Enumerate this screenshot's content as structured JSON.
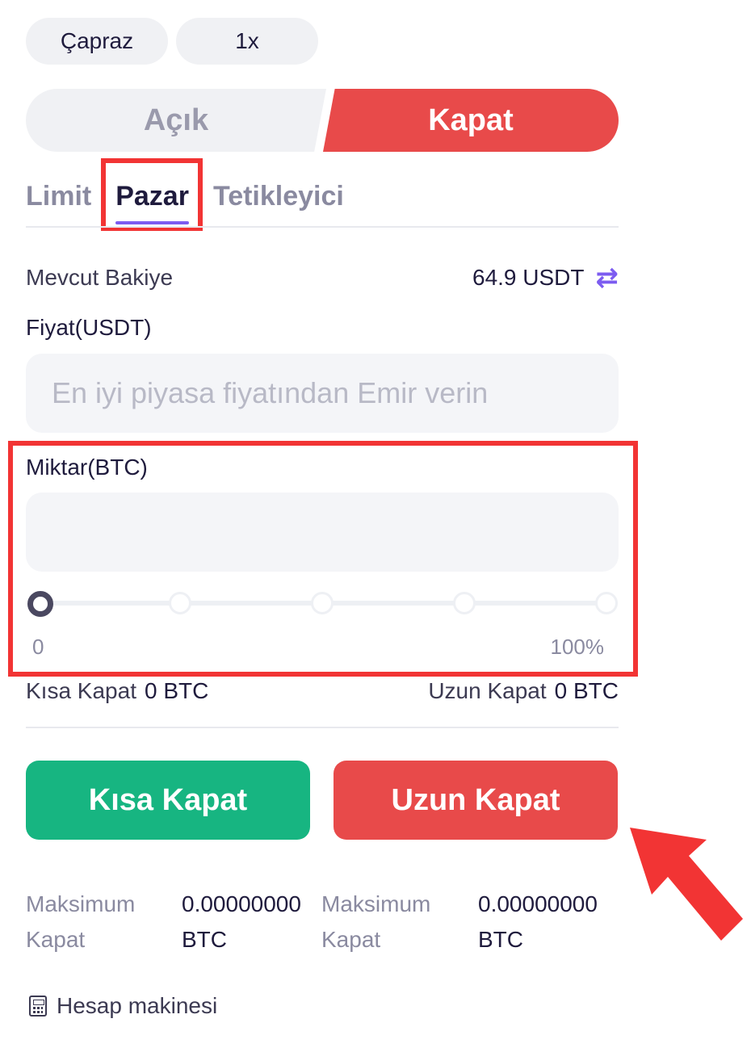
{
  "header": {
    "margin_mode": "Çapraz",
    "leverage": "1x"
  },
  "side_toggle": {
    "open_label": "Açık",
    "close_label": "Kapat",
    "active": "Kapat"
  },
  "order_tabs": [
    {
      "label": "Limit",
      "active": false
    },
    {
      "label": "Pazar",
      "active": true
    },
    {
      "label": "Tetikleyici",
      "active": false
    }
  ],
  "balance": {
    "label": "Mevcut Bakiye",
    "value": "64.9 USDT",
    "icon": "swap-arrows-icon"
  },
  "price": {
    "label": "Fiyat(USDT)",
    "placeholder": "En iyi piyasa fiyatından Emir verin"
  },
  "amount": {
    "label": "Miktar(BTC)",
    "value": "",
    "slider_min": "0",
    "slider_max": "100%",
    "slider_level": 0
  },
  "positions": {
    "short_label": "Kısa Kapat",
    "short_value": "0 BTC",
    "long_label": "Uzun Kapat",
    "long_value": "0 BTC"
  },
  "actions": {
    "close_short": "Kısa Kapat",
    "close_long": "Uzun Kapat"
  },
  "max_close": [
    {
      "label_line1": "Maksimum",
      "label_line2": "Kapat",
      "value_line1": "0.00000000",
      "value_line2": "BTC"
    },
    {
      "label_line1": "Maksimum",
      "label_line2": "Kapat",
      "value_line1": "0.00000000",
      "value_line2": "BTC"
    }
  ],
  "calculator": {
    "label": "Hesap makinesi",
    "icon": "calculator-icon"
  },
  "colors": {
    "accent": "#7c5cf0",
    "sell": "#e84a4a",
    "buy": "#17b581",
    "highlight": "#f23434"
  }
}
